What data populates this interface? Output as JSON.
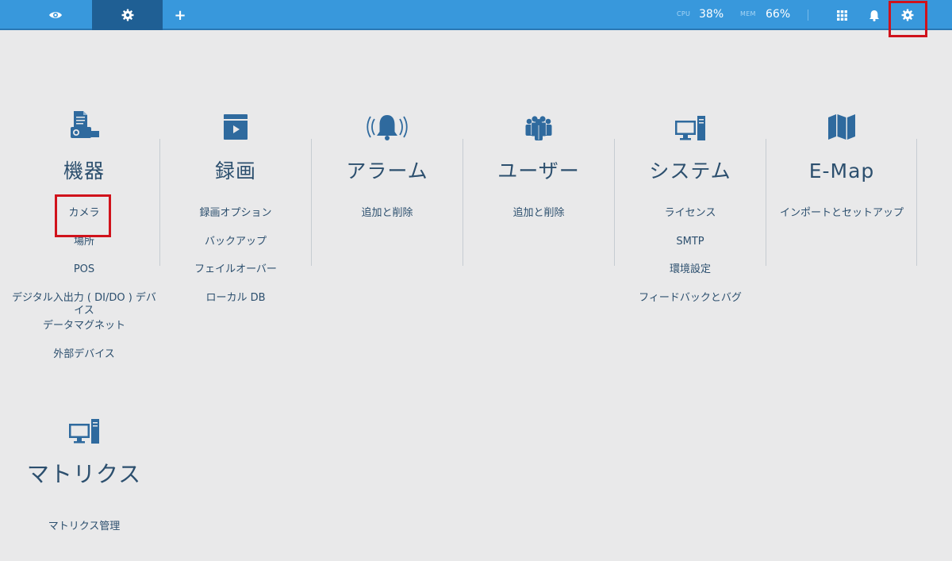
{
  "topbar": {
    "tabs": [
      {
        "name": "live-view",
        "icon": "eye-icon"
      },
      {
        "name": "settings",
        "icon": "gear-icon",
        "active": true
      },
      {
        "name": "add-tab",
        "icon": "plus-icon",
        "label": "+"
      }
    ],
    "cpu_label": "CPU",
    "cpu_value": "38%",
    "mem_label": "MEM",
    "mem_value": "66%",
    "right_icons": [
      "grid-icon",
      "bell-icon",
      "gear-icon"
    ],
    "bar_color": "#3898dc",
    "active_tab_color": "#1f5f94"
  },
  "categories": [
    {
      "title": "機器",
      "icon": "device-icon",
      "links": [
        "カメラ",
        "場所",
        "POS",
        "デジタル入出力 ( DI/DO ) デバイス",
        "データマグネット",
        "外部デバイス"
      ]
    },
    {
      "title": "録画",
      "icon": "video-icon",
      "links": [
        "録画オプション",
        "バックアップ",
        "フェイルオーバー",
        "ローカル DB"
      ]
    },
    {
      "title": "アラーム",
      "icon": "alarm-bell-icon",
      "links": [
        "追加と削除"
      ]
    },
    {
      "title": "ユーザー",
      "icon": "users-icon",
      "links": [
        "追加と削除"
      ]
    },
    {
      "title": "システム",
      "icon": "computer-icon",
      "links": [
        "ライセンス",
        "SMTP",
        "環境設定",
        "フィードバックとバグ"
      ]
    },
    {
      "title": "E-Map",
      "icon": "map-icon",
      "links": [
        "インポートとセットアップ"
      ]
    },
    {
      "title": "マトリクス",
      "icon": "computer-icon",
      "links": [
        "マトリクス管理"
      ]
    }
  ],
  "highlight_color": "#d0121b"
}
